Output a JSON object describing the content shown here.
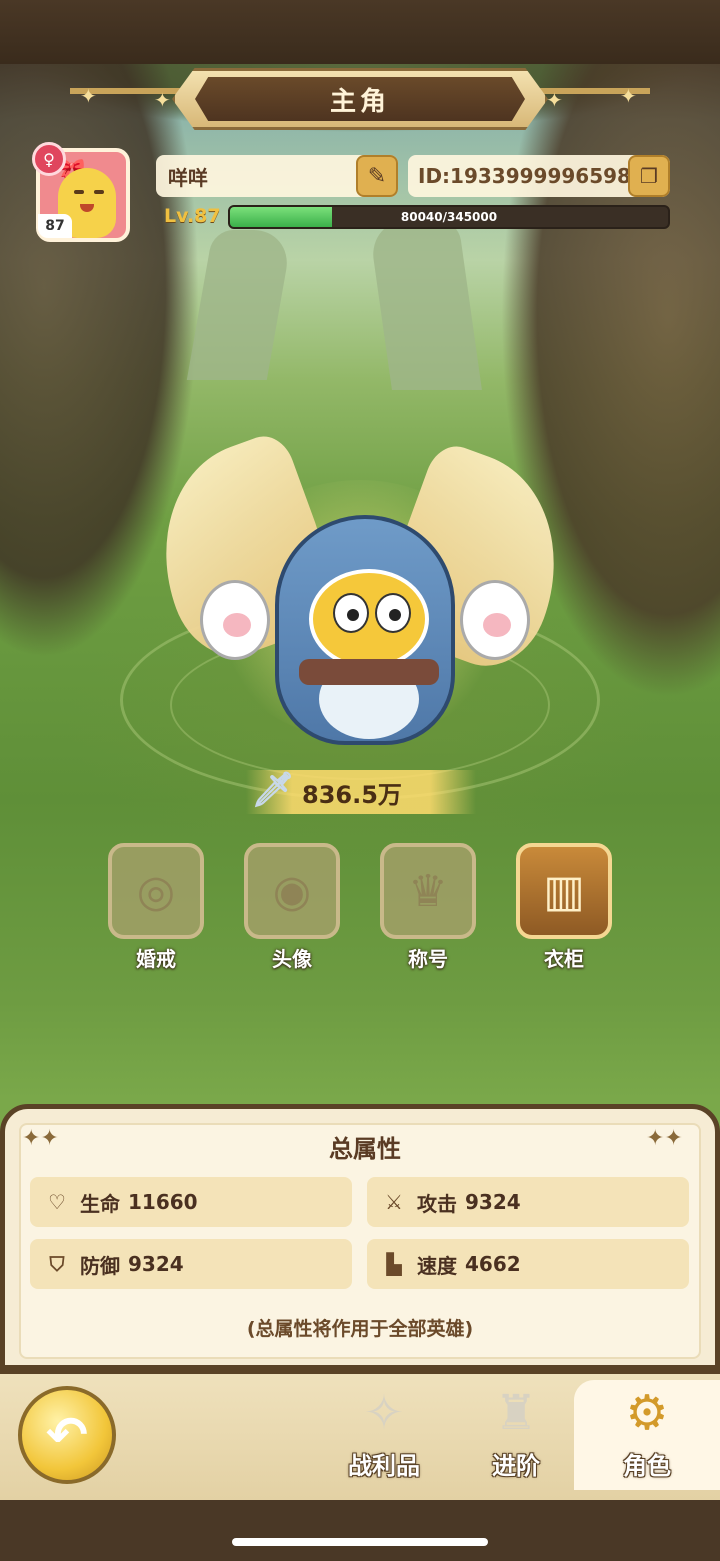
{
  "header": {
    "title": "主角"
  },
  "profile": {
    "avatar_level": "87",
    "name": "咩咩",
    "id_text": "ID:1933999996598",
    "level_label": "Lv.87",
    "exp_text": "80040/345000",
    "exp_progress": 0.232,
    "gender_icon": "female-symbol-icon"
  },
  "power": {
    "value": "836.5万",
    "icon": "sword-power-icon"
  },
  "features": [
    {
      "label": "婚戒",
      "icon": "ring-icon",
      "active": false
    },
    {
      "label": "头像",
      "icon": "portrait-icon",
      "active": false
    },
    {
      "label": "称号",
      "icon": "crown-title-icon",
      "active": false
    },
    {
      "label": "衣柜",
      "icon": "wardrobe-icon",
      "active": true
    }
  ],
  "attributes": {
    "title": "总属性",
    "items": [
      {
        "name": "生命",
        "value": "11660",
        "icon": "heart-icon"
      },
      {
        "name": "攻击",
        "value": "9324",
        "icon": "attack-claw-icon"
      },
      {
        "name": "防御",
        "value": "9324",
        "icon": "shield-icon"
      },
      {
        "name": "速度",
        "value": "4662",
        "icon": "boot-icon"
      }
    ],
    "note": "(总属性将作用于全部英雄)"
  },
  "bottom_nav": {
    "back_icon": "back-arrow-icon",
    "tabs": [
      {
        "label": "战利品",
        "icon": "loot-icon",
        "active": false
      },
      {
        "label": "进阶",
        "icon": "advance-icon",
        "active": false
      },
      {
        "label": "角色",
        "icon": "character-icon",
        "active": true
      }
    ]
  },
  "colors": {
    "accent_gold": "#e0b050",
    "exp_green": "#3bb04a",
    "panel_bg": "#f6ecd4",
    "frame_brown": "#5a4226"
  }
}
